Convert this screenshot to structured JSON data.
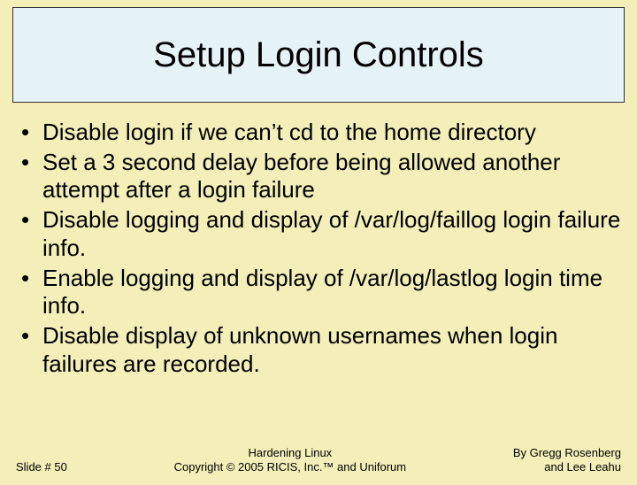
{
  "title": "Setup Login Controls",
  "bullets": [
    "Disable login if we can’t cd to the home directory",
    "Set a 3 second delay before being allowed another attempt after a login failure",
    "Disable logging and display of /var/log/faillog login failure info.",
    "Enable logging and display of /var/log/lastlog login time info.",
    "Disable display of unknown usernames when login failures are recorded."
  ],
  "footer": {
    "slide": "Slide # 50",
    "center_line1": "Hardening Linux",
    "center_line2": "Copyright © 2005 RICIS, Inc.™ and Uniforum",
    "right_line1": "By Gregg Rosenberg",
    "right_line2": "and Lee Leahu"
  }
}
